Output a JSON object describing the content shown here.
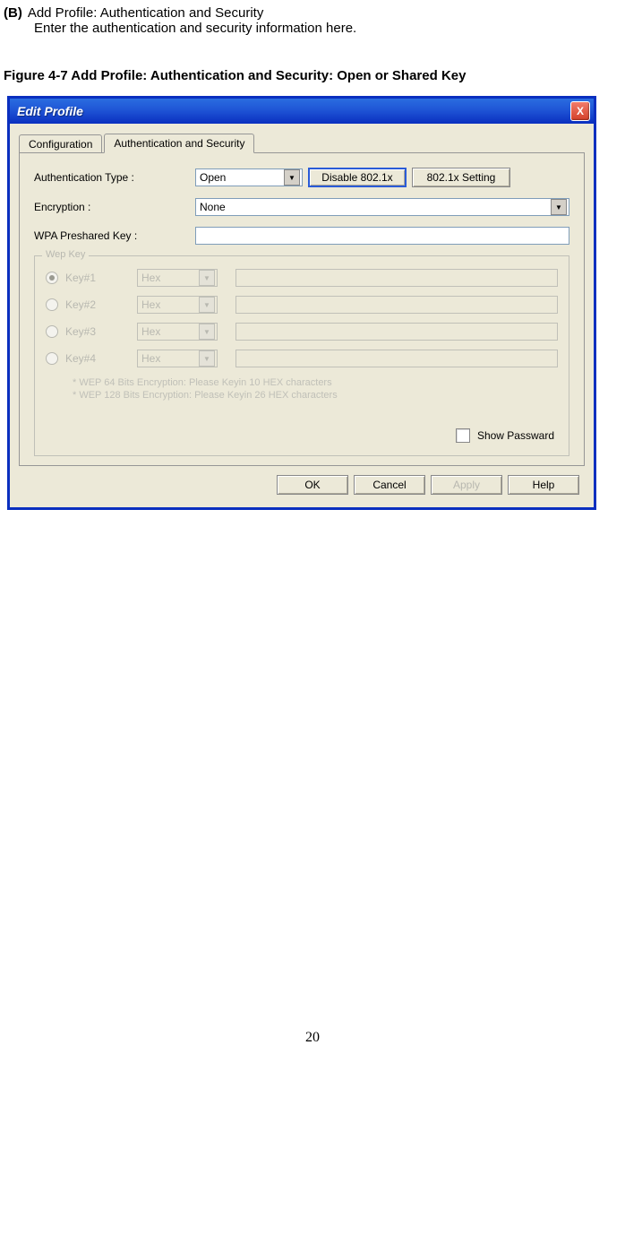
{
  "doc": {
    "section_marker": "(B)",
    "section_title": "Add Profile: Authentication and Security",
    "section_sub": "Enter the authentication and security information here.",
    "figure_caption": "Figure 4-7 Add Profile: Authentication and Security: Open or Shared Key",
    "page_number": "20"
  },
  "dialog": {
    "title": "Edit Profile",
    "close_icon": "X",
    "tabs": {
      "config": "Configuration",
      "auth": "Authentication and Security"
    },
    "labels": {
      "auth_type": "Authentication Type :",
      "encryption": "Encryption :",
      "wpa_psk": "WPA Preshared Key :"
    },
    "auth_type_value": "Open",
    "disable_8021x": "Disable 802.1x",
    "setting_8021x": "802.1x Setting",
    "encryption_value": "None",
    "wep": {
      "group_title": "Wep Key",
      "keys": [
        {
          "label": "Key#1",
          "mode": "Hex",
          "selected": true
        },
        {
          "label": "Key#2",
          "mode": "Hex",
          "selected": false
        },
        {
          "label": "Key#3",
          "mode": "Hex",
          "selected": false
        },
        {
          "label": "Key#4",
          "mode": "Hex",
          "selected": false
        }
      ],
      "hint1": "* WEP 64 Bits Encryption:    Please Keyin 10 HEX characters",
      "hint2": "* WEP 128 Bits Encryption:   Please Keyin 26 HEX characters"
    },
    "show_password": "Show Passward",
    "buttons": {
      "ok": "OK",
      "cancel": "Cancel",
      "apply": "Apply",
      "help": "Help"
    }
  }
}
